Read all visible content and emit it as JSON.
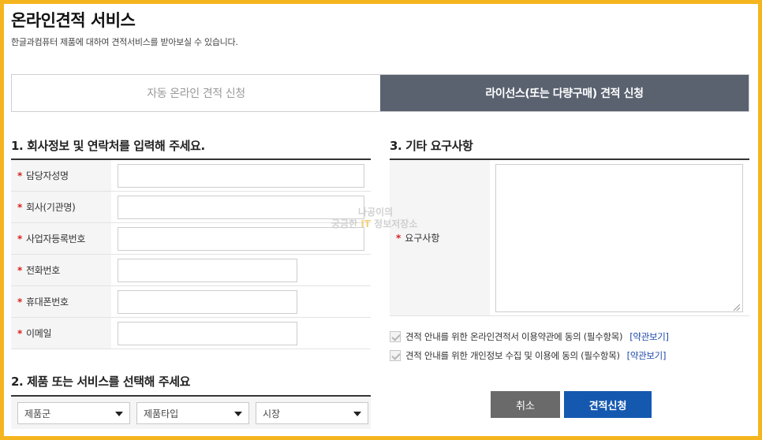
{
  "page": {
    "title": "온라인견적 서비스",
    "description": "한글과컴퓨터 제품에 대하여 견적서비스를 받아보실 수 있습니다."
  },
  "tabs": [
    {
      "label": "자동 온라인 견적 신청",
      "active": false
    },
    {
      "label": "라이선스(또는 다량구매) 견적 신청",
      "active": true
    }
  ],
  "section1": {
    "title": "1. 회사정보 및 연락처를 입력해 주세요.",
    "fields": [
      {
        "label": "담당자성명",
        "value": ""
      },
      {
        "label": "회사(기관명)",
        "value": ""
      },
      {
        "label": "사업자등록번호",
        "value": ""
      },
      {
        "label": "전화번호",
        "value": ""
      },
      {
        "label": "휴대폰번호",
        "value": ""
      },
      {
        "label": "이메일",
        "value": ""
      }
    ],
    "required_mark": "*"
  },
  "section2": {
    "title": "2. 제품 또는 서비스를 선택해 주세요",
    "selects": [
      {
        "value": "제품군"
      },
      {
        "value": "제품타입"
      },
      {
        "value": "시장"
      }
    ]
  },
  "section3": {
    "title": "3. 기타 요구사항",
    "label": "요구사항",
    "value": ""
  },
  "agreements": [
    {
      "text": "견적 안내를 위한 온라인견적서 이용약관에 동의 (필수항목)",
      "link": "[약관보기]"
    },
    {
      "text": "견적 안내를 위한 개인정보 수집 및 이용에 동의 (필수항목)",
      "link": "[약관보기]"
    }
  ],
  "buttons": {
    "cancel": "취소",
    "submit": "견적신청"
  },
  "watermark": {
    "line1": "나공이의",
    "line2a": "궁금한",
    "line2b": "IT",
    "line2c": "정보저장소"
  },
  "colors": {
    "frame": "#f5b51e",
    "active_tab": "#5a6270",
    "submit": "#1558b0",
    "cancel": "#6a6a6a",
    "required": "#d62020",
    "link": "#1f4aa8"
  }
}
